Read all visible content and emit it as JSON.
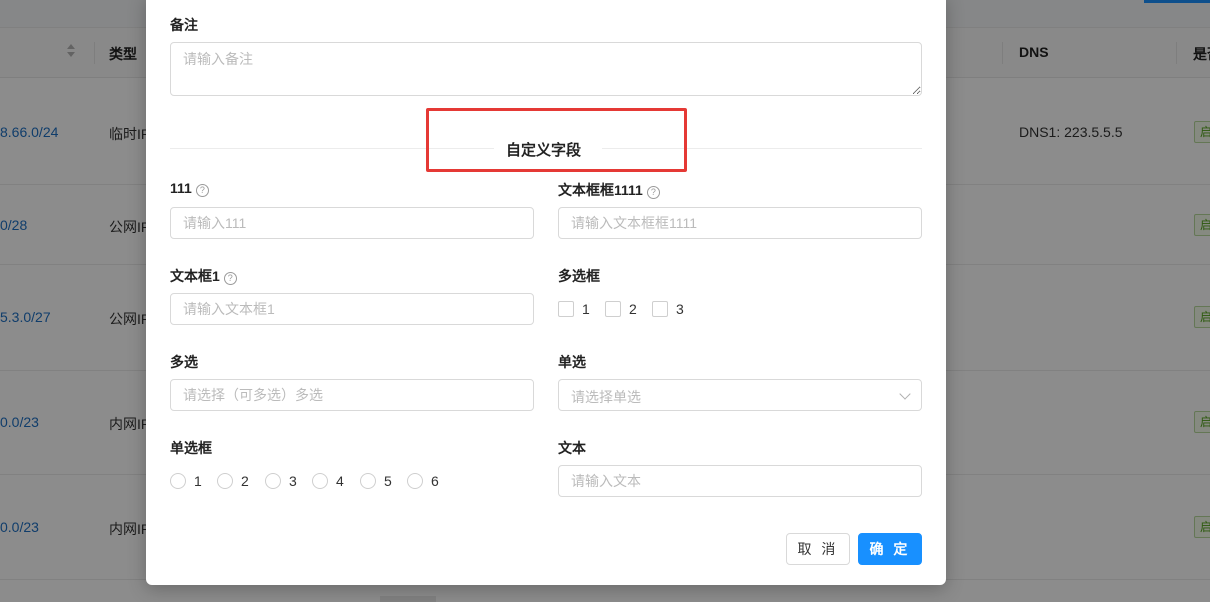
{
  "table": {
    "headers": {
      "type": "类型",
      "dns": "DNS",
      "status_partial": "是否"
    },
    "rows": [
      {
        "network": "8.66.0/24",
        "type": "临时IP",
        "dns": "DNS1: 223.5.5.5",
        "tag": "启用"
      },
      {
        "network": "0/28",
        "type": "公网IP",
        "dns": "",
        "tag": "启用"
      },
      {
        "network": "5.3.0/27",
        "type": "公网IP",
        "dns": "",
        "tag": "启用"
      },
      {
        "network": "0.0/23",
        "type": "内网IP",
        "dns": "",
        "tag": "启用"
      },
      {
        "network": "0.0/23",
        "type": "内网IP",
        "dns": "",
        "tag": "启用"
      }
    ]
  },
  "form": {
    "remark": {
      "label": "备注",
      "placeholder": "请输入备注"
    },
    "section_title": "自定义字段",
    "field_111": {
      "label": "111",
      "placeholder": "请输入111"
    },
    "field_textbox1111": {
      "label": "文本框框1111",
      "placeholder": "请输入文本框框1111"
    },
    "field_textbox1": {
      "label": "文本框1",
      "placeholder": "请输入文本框1"
    },
    "checkbox_group": {
      "label": "多选框",
      "options": [
        "1",
        "2",
        "3"
      ]
    },
    "multi_select": {
      "label": "多选",
      "placeholder": "请选择（可多选）多选"
    },
    "single_select": {
      "label": "单选",
      "placeholder": "请选择单选"
    },
    "radio_group": {
      "label": "单选框",
      "options": [
        "1",
        "2",
        "3",
        "4",
        "5",
        "6"
      ]
    },
    "text_field": {
      "label": "文本",
      "placeholder": "请输入文本"
    },
    "help_glyph": "?"
  },
  "buttons": {
    "cancel": "取 消",
    "ok": "确 定"
  },
  "colors": {
    "primary": "#1890ff",
    "highlight": "#e53935",
    "link": "#1e70c4"
  }
}
